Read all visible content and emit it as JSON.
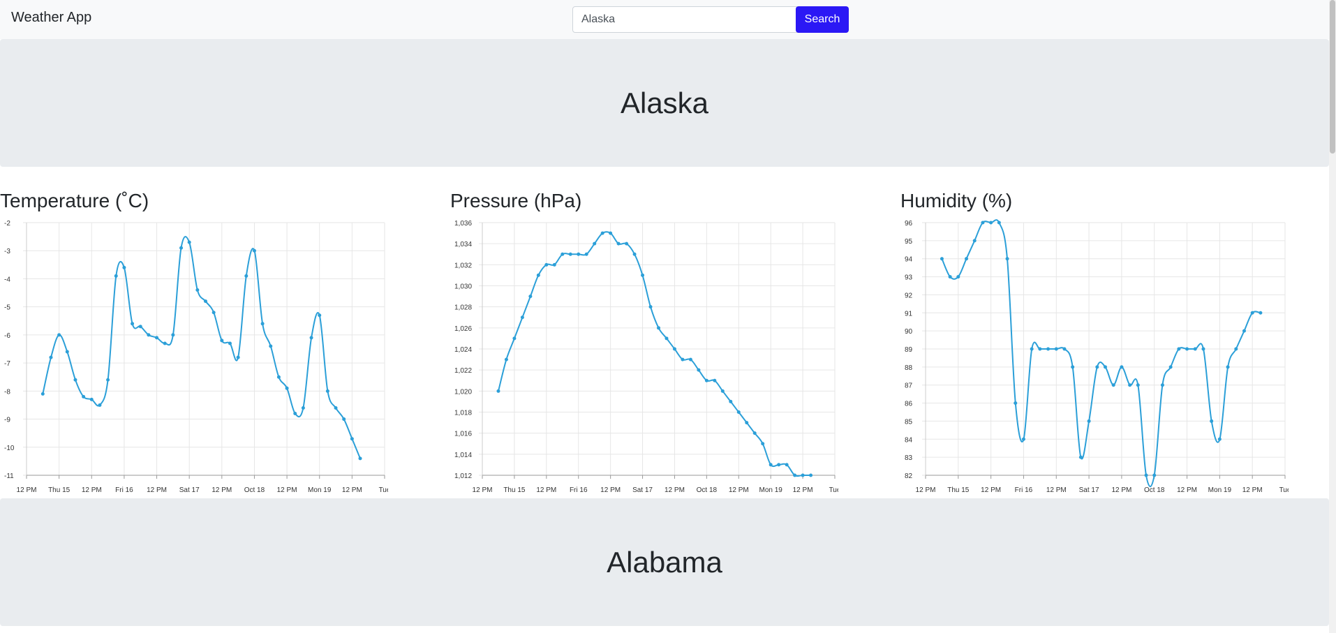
{
  "app": {
    "brand": "Weather App"
  },
  "search": {
    "value": "Alaska",
    "button_label": "Search"
  },
  "locations": [
    "Alaska",
    "Alabama"
  ],
  "colors": {
    "line": "#2b9fd8",
    "search_button": "#2b18f5",
    "jumbotron": "#e9ecef"
  },
  "x_ticks": [
    "12 PM",
    "Thu 15",
    "12 PM",
    "Fri 16",
    "12 PM",
    "Sat 17",
    "12 PM",
    "Oct 18",
    "12 PM",
    "Mon 19",
    "12 PM",
    "Tue"
  ],
  "charts": {
    "temperature": {
      "title": "Temperature (˚C)"
    },
    "pressure": {
      "title": "Pressure (hPa)"
    },
    "humidity": {
      "title": "Humidity (%)"
    }
  },
  "chart_data": [
    {
      "type": "line",
      "title": "Temperature (˚C)",
      "xlabel": "",
      "ylabel": "",
      "x_tick_labels": [
        "12 PM",
        "Thu 15",
        "12 PM",
        "Fri 16",
        "12 PM",
        "Sat 17",
        "12 PM",
        "Oct 18",
        "12 PM",
        "Mon 19",
        "12 PM",
        "Tue"
      ],
      "x_range_hours": [
        0,
        132
      ],
      "ylim": [
        -11,
        -2
      ],
      "y_ticks": [
        -2,
        -3,
        -4,
        -5,
        -6,
        -7,
        -8,
        -9,
        -10,
        -11
      ],
      "y_tick_labels": [
        "-2",
        "-3",
        "-4",
        "-5",
        "-6",
        "-7",
        "-8",
        "-9",
        "-10",
        "-11"
      ],
      "grid": true,
      "series": [
        {
          "x": [
            6,
            9,
            12,
            15,
            18,
            21,
            24,
            27,
            30,
            33,
            36,
            39,
            42,
            45,
            48,
            51,
            54,
            57,
            60,
            63,
            66,
            69,
            72,
            75,
            78,
            81,
            84,
            87,
            90,
            93,
            96,
            99,
            102,
            105,
            108,
            111,
            114,
            117,
            120,
            123
          ],
          "y": [
            -8.1,
            -6.8,
            -6.0,
            -6.6,
            -7.6,
            -8.2,
            -8.3,
            -8.5,
            -7.6,
            -3.9,
            -3.6,
            -5.6,
            -5.7,
            -6.0,
            -6.1,
            -6.3,
            -6.0,
            -2.9,
            -2.7,
            -4.4,
            -4.8,
            -5.2,
            -6.2,
            -6.3,
            -6.8,
            -3.9,
            -3.0,
            -5.6,
            -6.4,
            -7.5,
            -7.9,
            -8.8,
            -8.6,
            -6.1,
            -5.3,
            -8.0,
            -8.6,
            -9.0,
            -9.7,
            -10.4
          ]
        }
      ]
    },
    {
      "type": "line",
      "title": "Pressure (hPa)",
      "xlabel": "",
      "ylabel": "",
      "x_tick_labels": [
        "12 PM",
        "Thu 15",
        "12 PM",
        "Fri 16",
        "12 PM",
        "Sat 17",
        "12 PM",
        "Oct 18",
        "12 PM",
        "Mon 19",
        "12 PM",
        "Tue"
      ],
      "x_range_hours": [
        0,
        132
      ],
      "ylim": [
        1012,
        1036
      ],
      "y_ticks": [
        1036,
        1034,
        1032,
        1030,
        1028,
        1026,
        1024,
        1022,
        1020,
        1018,
        1016,
        1014,
        1012
      ],
      "y_tick_labels": [
        "1,036",
        "1,034",
        "1,032",
        "1,030",
        "1,028",
        "1,026",
        "1,024",
        "1,022",
        "1,020",
        "1,018",
        "1,016",
        "1,014",
        "1,012"
      ],
      "grid": true,
      "series": [
        {
          "x": [
            6,
            9,
            12,
            15,
            18,
            21,
            24,
            27,
            30,
            33,
            36,
            39,
            42,
            45,
            48,
            51,
            54,
            57,
            60,
            63,
            66,
            69,
            72,
            75,
            78,
            81,
            84,
            87,
            90,
            93,
            96,
            99,
            102,
            105,
            108,
            111,
            114,
            117,
            120,
            123
          ],
          "y": [
            1020,
            1023,
            1025,
            1027,
            1029,
            1031,
            1032,
            1032,
            1033,
            1033,
            1033,
            1033,
            1034,
            1035,
            1035,
            1034,
            1034,
            1033,
            1031,
            1028,
            1026,
            1025,
            1024,
            1023,
            1023,
            1022,
            1021,
            1021,
            1020,
            1019,
            1018,
            1017,
            1016,
            1015,
            1013,
            1013,
            1013,
            1012,
            1012,
            1012
          ]
        }
      ]
    },
    {
      "type": "line",
      "title": "Humidity (%)",
      "xlabel": "",
      "ylabel": "",
      "x_tick_labels": [
        "12 PM",
        "Thu 15",
        "12 PM",
        "Fri 16",
        "12 PM",
        "Sat 17",
        "12 PM",
        "Oct 18",
        "12 PM",
        "Mon 19",
        "12 PM",
        "Tue"
      ],
      "x_range_hours": [
        0,
        132
      ],
      "ylim": [
        82,
        96
      ],
      "y_ticks": [
        96,
        95,
        94,
        93,
        92,
        91,
        90,
        89,
        88,
        87,
        86,
        85,
        84,
        83,
        82
      ],
      "y_tick_labels": [
        "96",
        "95",
        "94",
        "93",
        "92",
        "91",
        "90",
        "89",
        "88",
        "87",
        "86",
        "85",
        "84",
        "83",
        "82"
      ],
      "grid": true,
      "series": [
        {
          "x": [
            6,
            9,
            12,
            15,
            18,
            21,
            24,
            27,
            30,
            33,
            36,
            39,
            42,
            45,
            48,
            51,
            54,
            57,
            60,
            63,
            66,
            69,
            72,
            75,
            78,
            81,
            84,
            87,
            90,
            93,
            96,
            99,
            102,
            105,
            108,
            111,
            114,
            117,
            120,
            123
          ],
          "y": [
            94,
            93,
            93,
            94,
            95,
            96,
            96,
            96,
            94,
            86,
            84,
            89,
            89,
            89,
            89,
            89,
            88,
            83,
            85,
            88,
            88,
            87,
            88,
            87,
            87,
            82,
            82,
            87,
            88,
            89,
            89,
            89,
            89,
            85,
            84,
            88,
            89,
            90,
            91,
            91
          ]
        }
      ]
    }
  ]
}
